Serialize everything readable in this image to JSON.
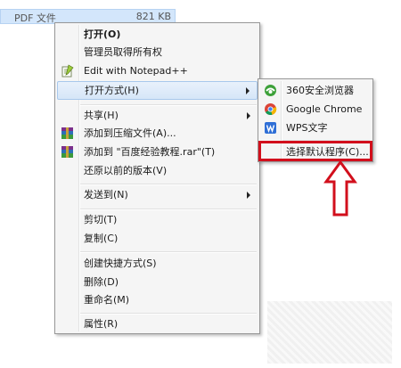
{
  "selected_file": {
    "name": "PDF 文件",
    "size": "821 KB"
  },
  "context_menu": {
    "items": [
      {
        "label": "打开(O)"
      },
      {
        "label": "管理员取得所有权"
      },
      {
        "label": "Edit with Notepad++",
        "icon": "notepad-plus-icon"
      },
      {
        "label": "打开方式(H)"
      },
      {
        "label": "共享(H)"
      },
      {
        "label": "添加到压缩文件(A)...",
        "icon": "winrar-icon"
      },
      {
        "label": "添加到 \"百度经验教程.rar\"(T)",
        "icon": "winrar-icon"
      },
      {
        "label": "还原以前的版本(V)"
      },
      {
        "label": "发送到(N)"
      },
      {
        "label": "剪切(T)"
      },
      {
        "label": "复制(C)"
      },
      {
        "label": "创建快捷方式(S)"
      },
      {
        "label": "删除(D)"
      },
      {
        "label": "重命名(M)"
      },
      {
        "label": "属性(R)"
      }
    ]
  },
  "open_with_submenu": {
    "items": [
      {
        "label": "360安全浏览器",
        "icon": "360-browser-icon"
      },
      {
        "label": "Google Chrome",
        "icon": "chrome-icon"
      },
      {
        "label": "WPS文字",
        "icon": "wps-writer-icon"
      },
      {
        "label": "选择默认程序(C)..."
      }
    ]
  },
  "colors": {
    "highlight": "#d20f1c",
    "menu_bg": "#f5f5f5",
    "hover_bg": "#d6e6f8",
    "selection_bg": "#d3e6fb"
  }
}
